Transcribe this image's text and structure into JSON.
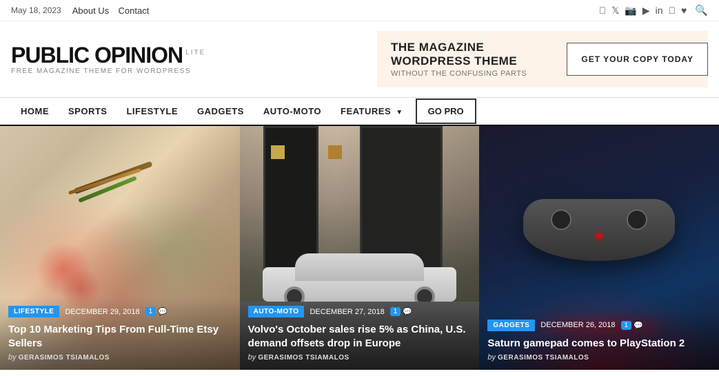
{
  "topbar": {
    "date": "May 18, 2023",
    "nav": [
      {
        "label": "About Us",
        "id": "about-us"
      },
      {
        "label": "Contact",
        "id": "contact"
      }
    ],
    "socials": [
      "facebook",
      "twitter",
      "instagram",
      "youtube",
      "linkedin",
      "wordpress",
      "rss"
    ],
    "search_title": "Search"
  },
  "header": {
    "logo_title": "PUBLIC OPINION",
    "logo_lite": "LITE",
    "logo_subtitle": "FREE MAGAZINE THEME FOR WORDPRESS",
    "promo_main": "THE MAGAZINE WORDPRESS THEME",
    "promo_sub": "WITHOUT THE CONFUSING PARTS",
    "cta_label": "GET YOUR COPY TODAY"
  },
  "nav": {
    "items": [
      {
        "label": "HOME",
        "active": true,
        "has_dropdown": false
      },
      {
        "label": "SPORTS",
        "active": false,
        "has_dropdown": false
      },
      {
        "label": "LIFESTYLE",
        "active": false,
        "has_dropdown": false
      },
      {
        "label": "GADGETS",
        "active": false,
        "has_dropdown": false
      },
      {
        "label": "AUTO-MOTO",
        "active": false,
        "has_dropdown": false
      },
      {
        "label": "FEATURES",
        "active": false,
        "has_dropdown": true
      }
    ],
    "gopro_label": "GO PRO"
  },
  "cards": [
    {
      "tag": "LIFESTYLE",
      "tag_class": "tag-lifestyle",
      "date": "DECEMBER 29, 2018",
      "comments": "1",
      "title": "Top 10 Marketing Tips From Full-Time Etsy Sellers",
      "author_by": "by",
      "author": "GERASIMOS TSIAMALOS"
    },
    {
      "tag": "AUTO-MOTO",
      "tag_class": "tag-auto-moto",
      "date": "DECEMBER 27, 2018",
      "comments": "1",
      "title": "Volvo's October sales rise 5% as China, U.S. demand offsets drop in Europe",
      "author_by": "by",
      "author": "GERASIMOS TSIAMALOS"
    },
    {
      "tag": "GADGETS",
      "tag_class": "tag-gadgets",
      "date": "DECEMBER 26, 2018",
      "comments": "1",
      "title": "Saturn gamepad comes to PlayStation 2",
      "author_by": "by",
      "author": "GERASIMOS TSIAMALOS"
    }
  ]
}
